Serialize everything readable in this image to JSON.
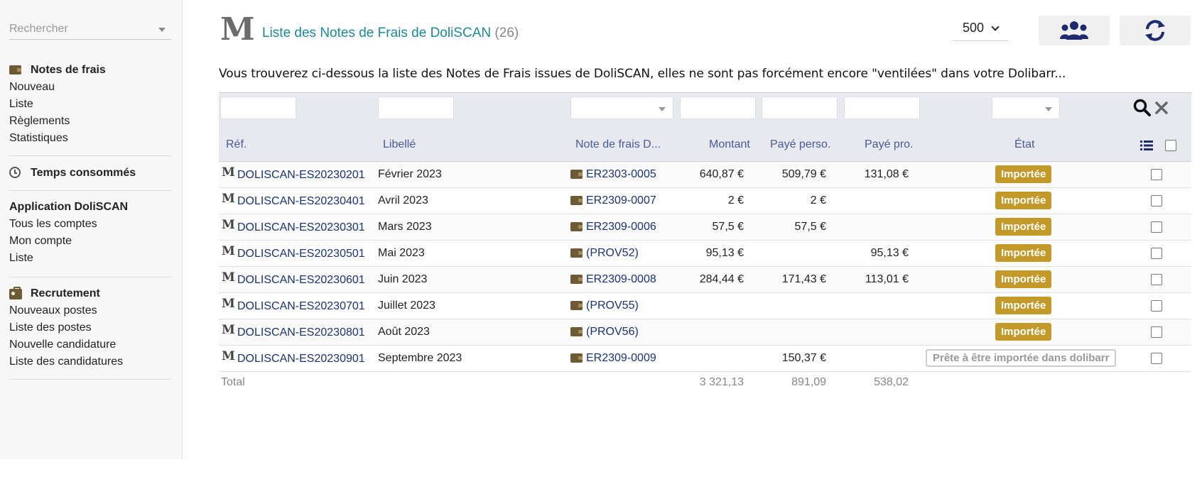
{
  "sidebar": {
    "search_placeholder": "Rechercher",
    "sections": [
      {
        "title": "Notes de frais",
        "icon": "wallet-icon",
        "items": [
          "Nouveau",
          "Liste",
          "Règlements",
          "Statistiques"
        ]
      },
      {
        "title": "Temps consommés",
        "icon": "clock-icon",
        "items": []
      },
      {
        "title": "Application DoliSCAN",
        "icon": "",
        "items": [
          "Tous les comptes",
          "Mon compte",
          "Liste"
        ]
      },
      {
        "title": "Recrutement",
        "icon": "id-badge-icon",
        "items": [
          "Nouveaux postes",
          "Liste des postes",
          "Nouvelle candidature",
          "Liste des candidatures"
        ]
      }
    ]
  },
  "header": {
    "logo_letter": "M",
    "title": "Liste des Notes de Frais de DoliSCAN",
    "count": "(26)",
    "limit_value": "500",
    "intro": "Vous trouverez ci-dessous la liste des Notes de Frais issues de DoliSCAN, elles ne sont pas forcément encore \"ventilées\" dans votre Dolibarr..."
  },
  "table": {
    "columns": [
      "Réf.",
      "Libellé",
      "Note de frais D...",
      "Montant",
      "Payé perso.",
      "Payé pro.",
      "État"
    ],
    "rows": [
      {
        "ref": "DOLISCAN-ES20230201",
        "label": "Février 2023",
        "note": "ER2303-0005",
        "amount": "640,87 €",
        "perso": "509,79 €",
        "pro": "131,08 €",
        "status": "Importée"
      },
      {
        "ref": "DOLISCAN-ES20230401",
        "label": "Avril 2023",
        "note": "ER2309-0007",
        "amount": "2 €",
        "perso": "2 €",
        "pro": "",
        "status": "Importée"
      },
      {
        "ref": "DOLISCAN-ES20230301",
        "label": "Mars 2023",
        "note": "ER2309-0006",
        "amount": "57,5 €",
        "perso": "57,5 €",
        "pro": "",
        "status": "Importée"
      },
      {
        "ref": "DOLISCAN-ES20230501",
        "label": "Mai 2023",
        "note": "(PROV52)",
        "amount": "95,13 €",
        "perso": "",
        "pro": "95,13 €",
        "status": "Importée"
      },
      {
        "ref": "DOLISCAN-ES20230601",
        "label": "Juin 2023",
        "note": "ER2309-0008",
        "amount": "284,44 €",
        "perso": "171,43 €",
        "pro": "113,01 €",
        "status": "Importée"
      },
      {
        "ref": "DOLISCAN-ES20230701",
        "label": "Juillet 2023",
        "note": "(PROV55)",
        "amount": "",
        "perso": "",
        "pro": "",
        "status": "Importée"
      },
      {
        "ref": "DOLISCAN-ES20230801",
        "label": "Août 2023",
        "note": "(PROV56)",
        "amount": "",
        "perso": "",
        "pro": "",
        "status": "Importée"
      },
      {
        "ref": "DOLISCAN-ES20230901",
        "label": "Septembre 2023",
        "note": "ER2309-0009",
        "amount": "",
        "perso": "150,37 €",
        "pro": "",
        "status": "Prête à être importée dans dolibarr"
      }
    ],
    "total": {
      "label": "Total",
      "amount": "3 321,13",
      "perso": "891,09",
      "pro": "538,02"
    }
  },
  "colors": {
    "accent_teal": "#1a8a9a",
    "link_navy": "#1a3372",
    "status_imported": "#c39a2a",
    "header_bg": "#e8e9ee",
    "icon_navy": "#1e2a6e"
  }
}
